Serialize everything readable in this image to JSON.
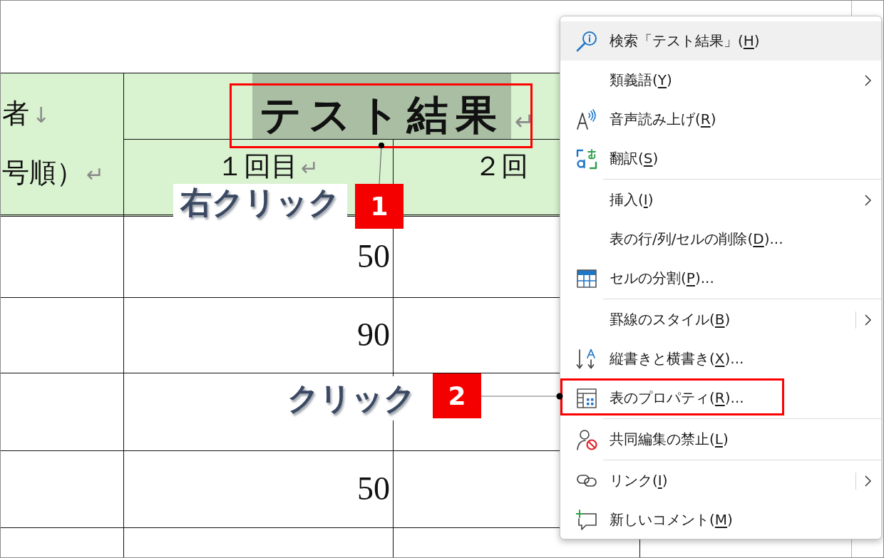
{
  "table": {
    "corner_header": {
      "lines": [
        {
          "text": "者",
          "mark": "↓"
        },
        {
          "text": "号順）",
          "mark": "↵"
        }
      ]
    },
    "group_header": {
      "text": "テスト結果",
      "mark": "↵",
      "highlighted": true
    },
    "sub_headers": [
      {
        "text": "１回目",
        "mark": "↵"
      },
      {
        "text": "２回"
      }
    ],
    "rows": [
      {
        "column_2": "50"
      },
      {
        "column_2": "90"
      },
      {},
      {
        "column_2": "50"
      },
      {}
    ]
  },
  "context_menu": {
    "groups": [
      {
        "items": [
          {
            "label": "検索「テスト結果」(",
            "access_key": "H",
            "after": ")",
            "highlighted": true,
            "submenu": false,
            "split": false,
            "framed": false
          },
          {
            "label": "類義語(",
            "access_key": "Y",
            "after": ")",
            "highlighted": false,
            "submenu": true,
            "split": false,
            "framed": false
          },
          {
            "label": "音声読み上げ(",
            "access_key": "R",
            "after": ")",
            "highlighted": false,
            "submenu": false,
            "split": false,
            "framed": false
          },
          {
            "label": "翻訳(",
            "access_key": "S",
            "after": ")",
            "highlighted": false,
            "submenu": false,
            "split": false,
            "framed": false
          }
        ]
      },
      {
        "items": [
          {
            "label": "挿入(",
            "access_key": "I",
            "after": ")",
            "highlighted": false,
            "submenu": true,
            "split": false,
            "framed": false
          },
          {
            "label": "表の行/列/セルの削除(",
            "access_key": "D",
            "after": ")...",
            "highlighted": false,
            "submenu": false,
            "split": false,
            "framed": false
          },
          {
            "label": "セルの分割(",
            "access_key": "P",
            "after": ")...",
            "highlighted": false,
            "submenu": false,
            "split": false,
            "framed": false
          }
        ]
      },
      {
        "items": [
          {
            "label": "罫線のスタイル(",
            "access_key": "B",
            "after": ")",
            "highlighted": false,
            "submenu": true,
            "split": true,
            "framed": false
          },
          {
            "label": "縦書きと横書き(",
            "access_key": "X",
            "after": ")...",
            "highlighted": false,
            "submenu": false,
            "split": false,
            "framed": false
          },
          {
            "label": "表のプロパティ(",
            "access_key": "R",
            "after": ")...",
            "highlighted": false,
            "submenu": false,
            "split": false,
            "framed": true
          }
        ]
      },
      {
        "items": [
          {
            "label": "共同編集の禁止(",
            "access_key": "L",
            "after": ")",
            "highlighted": false,
            "submenu": false,
            "split": false,
            "framed": false
          }
        ]
      },
      {
        "items": [
          {
            "label": "リンク(",
            "access_key": "I",
            "after": ")",
            "highlighted": false,
            "submenu": true,
            "split": true,
            "framed": false
          },
          {
            "label": "新しいコメント(",
            "access_key": "M",
            "after": ")",
            "highlighted": false,
            "submenu": false,
            "split": false,
            "framed": false
          }
        ]
      }
    ]
  },
  "annotations": [
    {
      "number": "1",
      "label": "右クリック"
    },
    {
      "number": "2",
      "label": "クリック"
    }
  ]
}
